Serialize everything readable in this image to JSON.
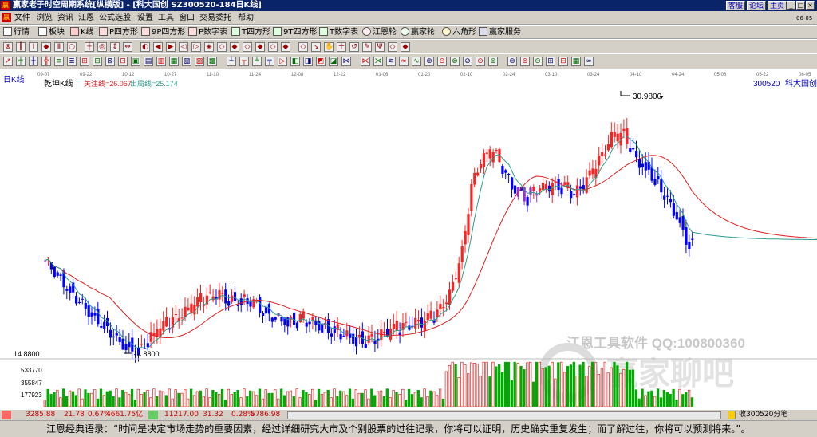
{
  "window": {
    "logo": "赢",
    "title": "赢家老子时空周期系统[纵横版] - [科大国创 SZ300520-184日K线]",
    "links": [
      "客服",
      "论坛",
      "主页"
    ],
    "controls": [
      "_",
      "□",
      "×"
    ]
  },
  "menu": {
    "items": [
      "文件",
      "浏览",
      "资讯",
      "江恩",
      "公式选股",
      "设置",
      "工具",
      "窗口",
      "交易委托",
      "帮助"
    ],
    "date_corner": "06-05"
  },
  "toolbar1": {
    "items": [
      "行情",
      "板块",
      "K线",
      "P四方形",
      "9P四方形",
      "P数字表",
      "T四方形",
      "9T四方形",
      "T数字表",
      "江恩轮",
      "赢家轮",
      "六角形",
      "赢家服务"
    ]
  },
  "chart": {
    "period_label": "日K线",
    "indicator_name": "乾坤K线",
    "focus_line": "关注线=26.067",
    "exit_line": "出局线=25.174",
    "stock_code": "300520",
    "stock_name": "科大国创",
    "high_label": "30.9800",
    "low_label": "14.8800",
    "price_axis_label": "14.8800",
    "volume_ticks": [
      "533770",
      "355847",
      "177923"
    ],
    "watermark": "江恩工具软件  QQ:100800360",
    "watermark2": "赢家聊吧",
    "date_ticks": [
      "09-07",
      "09-22",
      "10-12",
      "10-27",
      "11-10",
      "11-24",
      "12-08",
      "12-22",
      "01-06",
      "01-20",
      "02-10",
      "02-24",
      "03-10",
      "03-24",
      "04-10",
      "04-24",
      "05-08",
      "05-22",
      "06-05"
    ],
    "colors": {
      "up": "#ff2020",
      "down": "#0000ff",
      "flat": "#9933cc",
      "ma_fast": "#2a9d8f",
      "ma_slow": "#e02020",
      "vol_up": "#e02020",
      "vol_down": "#00aa00"
    }
  },
  "chart_data": {
    "type": "candlestick",
    "title": "科大国创 SZ300520-184日K线",
    "x_range": [
      "09-07",
      "06-05"
    ],
    "y_range": [
      14.88,
      30.98
    ],
    "labels": {
      "high": 30.98,
      "low": 14.88
    },
    "indicator_lines": [
      {
        "name": "关注线",
        "value": 26.067
      },
      {
        "name": "出局线",
        "value": 25.174
      }
    ]
  },
  "status": {
    "sh_index": "3285.88",
    "sh_change": "21.78",
    "sh_pct": "0.67%",
    "sh_amount": "4661.75亿",
    "sz_index": "11217.00",
    "sz_change": "31.32",
    "sz_pct": "0.28%",
    "sz_amount": "5786.98",
    "right": "收300520分笔"
  },
  "quote": {
    "text": "江恩经典语录：“时间是决定市场走势的重要因素，经过详细研究大市及个别股票的过往记录，你将可以证明，历史确实重复发生；而了解过往，你将可以预测将来。”。"
  }
}
